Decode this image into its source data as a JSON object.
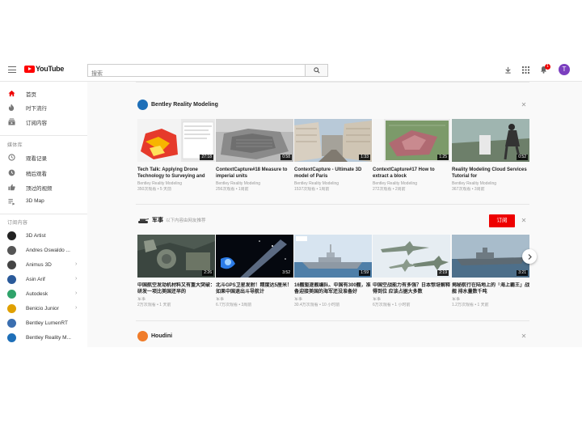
{
  "header": {
    "logo_text": "YouTube",
    "search_placeholder": "搜索",
    "notification_count": "1",
    "avatar_letter": "T"
  },
  "sidebar": {
    "main_items": [
      {
        "label": "首页",
        "icon": "home-icon",
        "active": true
      },
      {
        "label": "时下流行",
        "icon": "trending-icon"
      },
      {
        "label": "订阅内容",
        "icon": "subscriptions-icon"
      }
    ],
    "library_header": "媒体库",
    "library_items": [
      {
        "label": "观看记录",
        "icon": "history-icon"
      },
      {
        "label": "稍后观看",
        "icon": "watch-later-icon"
      },
      {
        "label": "顶过的视频",
        "icon": "liked-icon"
      },
      {
        "label": "3D Map",
        "icon": "playlist-icon"
      }
    ],
    "subs_header": "订阅内容",
    "subscriptions": [
      {
        "label": "3D Artist",
        "color": "#222222"
      },
      {
        "label": "Andres Oswaldo ...",
        "color": "#555555"
      },
      {
        "label": "Animus 3D",
        "color": "#444444",
        "chevron": "›"
      },
      {
        "label": "Asin Arif",
        "color": "#2a5a9a",
        "chevron": "›"
      },
      {
        "label": "Autodesk",
        "color": "#2fa36b",
        "chevron": "›"
      },
      {
        "label": "Benicio Junior",
        "color": "#e0a000",
        "chevron": "›"
      },
      {
        "label": "Bentley LumenRT",
        "color": "#3b6fb0"
      },
      {
        "label": "Bentley Reality M...",
        "color": "#1e6fb8"
      }
    ]
  },
  "shelves": [
    {
      "title": "Bentley Reality Modeling",
      "avatar_color": "#1e6fb8",
      "videos": [
        {
          "title": "Tech Talk: Applying Drone Technology to Surveying and",
          "channel": "Bentley Reality Modeling",
          "meta": "350次观看 • 5 天前",
          "duration": "27:18"
        },
        {
          "title": "ContextCapture#18 Measure to imperial units",
          "channel": "Bentley Reality Modeling",
          "meta": "256次观看 • 1周前",
          "duration": "0:58"
        },
        {
          "title": "ContextCapture - Ultimate 3D model of Paris",
          "channel": "Bentley Reality Modeling",
          "meta": "1537次观看 • 1周前",
          "duration": "1:33"
        },
        {
          "title": "ContextCapture#17 How to extract a block",
          "channel": "Bentley Reality Modeling",
          "meta": "272次观看 • 2周前",
          "duration": "1:25"
        },
        {
          "title": "Reality Modeling Cloud Services Tutorial for",
          "channel": "Bentley Reality Modeling",
          "meta": "367次观看 • 3周前",
          "duration": "0:52"
        }
      ]
    },
    {
      "title": "军事",
      "subtitle": "以下内容由网友推荐",
      "subscribe_label": "订阅",
      "videos": [
        {
          "title": "中国航空发动机材料又有重大突破：研发一项比美国还早的",
          "channel": "军事",
          "meta": "2万次观看 • 1 天前",
          "duration": "2:26"
        },
        {
          "title": "北斗GPS卫星发射！精度达5厘米！如果中国退出斗导航计",
          "channel": "军事",
          "meta": "6.7万次观看 • 3周前",
          "duration": "3:52"
        },
        {
          "title": "16艘驱逐舰编队、中国有300艘，准备迎接美国的海军还没准备好",
          "channel": "军事",
          "meta": "30.4万次观看 • 10 小时前",
          "duration": "1:59"
        },
        {
          "title": "中国空战能力有多强？日本惊讶解释得到位 应该占据大多数",
          "channel": "军事",
          "meta": "6万次观看 • 1 小时前",
          "duration": "2:19"
        },
        {
          "title": "揭秘航行在陆地上的「海上霸王」战舰 排水量数千吨",
          "channel": "军事",
          "meta": "1.2万次观看 • 1 天前",
          "duration": "3:21"
        }
      ]
    },
    {
      "title": "Houdini",
      "avatar_color": "#f07c2a"
    }
  ]
}
